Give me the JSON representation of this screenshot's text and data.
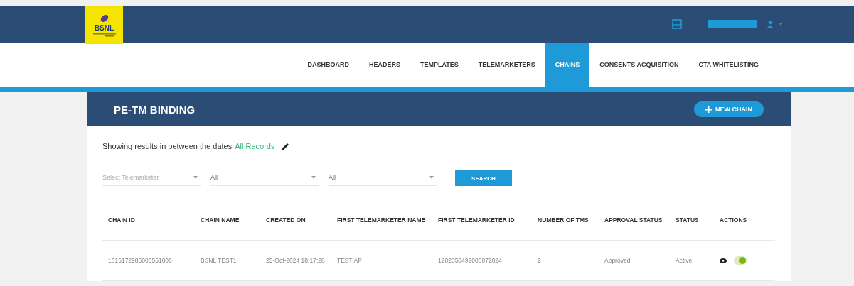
{
  "logo": {
    "text": "BSNL"
  },
  "nav": [
    {
      "label": "DASHBOARD",
      "selected": false
    },
    {
      "label": "HEADERS",
      "selected": false
    },
    {
      "label": "TEMPLATES",
      "selected": false
    },
    {
      "label": "TELEMARKETERS",
      "selected": false
    },
    {
      "label": "CHAINS",
      "selected": true
    },
    {
      "label": "CONSENTS ACQUISITION",
      "selected": false
    },
    {
      "label": "CTA WHITELISTING",
      "selected": false
    }
  ],
  "panel": {
    "title": "PE-TM BINDING",
    "new_button": "NEW CHAIN"
  },
  "date_filter": {
    "text": "Showing results in between the dates",
    "link": "All Records"
  },
  "filters": [
    {
      "placeholder": "Select Telemarketer"
    },
    {
      "value": "All"
    },
    {
      "value": "All"
    }
  ],
  "search_button": "SEARCH",
  "table": {
    "columns": [
      "CHAIN ID",
      "CHAIN NAME",
      "CREATED ON",
      "FIRST TELEMARKETER NAME",
      "FIRST TELEMARKETER ID",
      "NUMBER OF TMS",
      "APPROVAL STATUS",
      "STATUS",
      "ACTIONS"
    ],
    "rows": [
      {
        "cells": [
          "1015172985000551006",
          "BSNL TEST1",
          "25-Oct-2024 18:17:28",
          "TEST AP",
          "1202350492000072024",
          "2",
          "Approved",
          "Active"
        ],
        "enabled": true
      }
    ]
  }
}
